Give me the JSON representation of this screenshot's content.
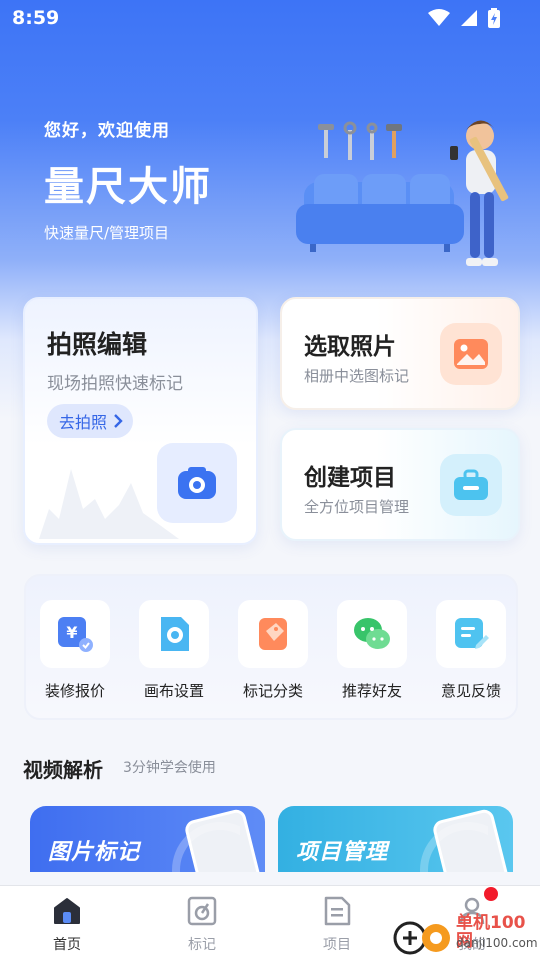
{
  "status_bar": {
    "time": "8:59"
  },
  "hero": {
    "greeting": "您好，欢迎使用",
    "title": "量尺大师",
    "subtitle": "快速量尺/管理项目"
  },
  "cards": {
    "photo_edit": {
      "title": "拍照编辑",
      "subtitle": "现场拍照快速标记",
      "button": "去拍照"
    },
    "pick_photo": {
      "title": "选取照片",
      "subtitle": "相册中选图标记"
    },
    "create_project": {
      "title": "创建项目",
      "subtitle": "全方位项目管理"
    }
  },
  "quick_menu": [
    {
      "label": "装修报价",
      "icon": "price-quote-icon"
    },
    {
      "label": "画布设置",
      "icon": "canvas-settings-icon"
    },
    {
      "label": "标记分类",
      "icon": "tag-category-icon"
    },
    {
      "label": "推荐好友",
      "icon": "wechat-share-icon"
    },
    {
      "label": "意见反馈",
      "icon": "feedback-icon"
    }
  ],
  "video_section": {
    "title": "视频解析",
    "subtitle": "3分钟学会使用",
    "videos": [
      {
        "title": "图片标记"
      },
      {
        "title": "项目管理"
      }
    ]
  },
  "tab_bar": {
    "tabs": [
      {
        "label": "首页",
        "icon": "home-icon",
        "active": true
      },
      {
        "label": "标记",
        "icon": "mark-icon",
        "active": false
      },
      {
        "label": "项目",
        "icon": "project-icon",
        "active": false
      },
      {
        "label": "我的",
        "icon": "profile-icon",
        "active": false
      }
    ]
  },
  "watermark": {
    "name": "单机100网",
    "url": "danji100.com"
  },
  "colors": {
    "primary": "#3d74f6",
    "badge": "#f21b2b",
    "orange": "#ff8a5c",
    "cyan": "#4cc3ef"
  }
}
